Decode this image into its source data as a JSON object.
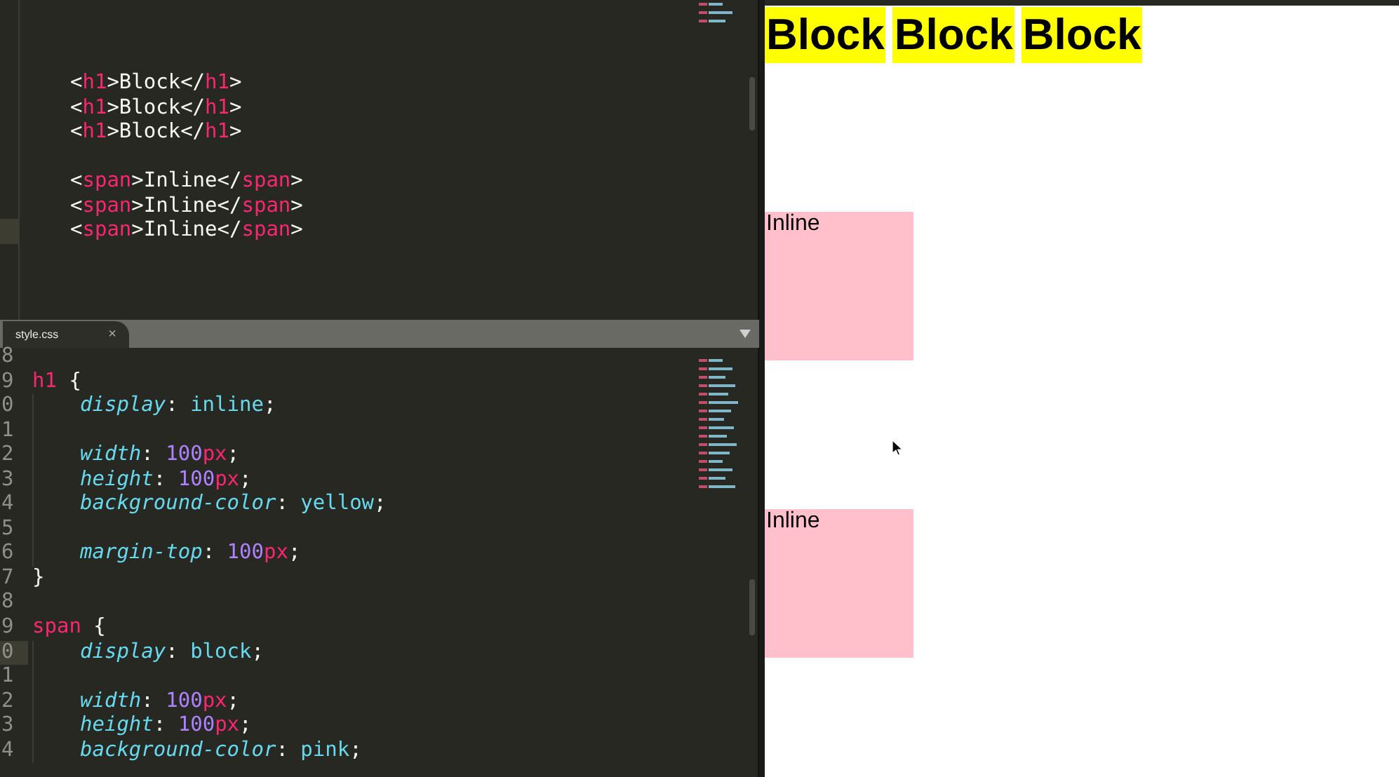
{
  "editor": {
    "html_groups": [
      [
        {
          "current": false,
          "tokens": [
            {
              "kind": "punct",
              "text": "<"
            },
            {
              "kind": "tag",
              "text": "h1"
            },
            {
              "kind": "punct",
              "text": ">Block</"
            },
            {
              "kind": "tag",
              "text": "h1"
            },
            {
              "kind": "punct",
              "text": ">"
            }
          ]
        },
        {
          "current": false,
          "tokens": [
            {
              "kind": "punct",
              "text": "<"
            },
            {
              "kind": "tag",
              "text": "h1"
            },
            {
              "kind": "punct",
              "text": ">Block</"
            },
            {
              "kind": "tag",
              "text": "h1"
            },
            {
              "kind": "punct",
              "text": ">"
            }
          ]
        },
        {
          "current": false,
          "tokens": [
            {
              "kind": "punct",
              "text": "<"
            },
            {
              "kind": "tag",
              "text": "h1"
            },
            {
              "kind": "punct",
              "text": ">Block</"
            },
            {
              "kind": "tag",
              "text": "h1"
            },
            {
              "kind": "punct",
              "text": ">"
            }
          ]
        }
      ],
      [
        {
          "current": false,
          "tokens": [
            {
              "kind": "punct",
              "text": "<"
            },
            {
              "kind": "tag",
              "text": "span"
            },
            {
              "kind": "punct",
              "text": ">Inline</"
            },
            {
              "kind": "tag",
              "text": "span"
            },
            {
              "kind": "punct",
              "text": ">"
            }
          ]
        },
        {
          "current": false,
          "tokens": [
            {
              "kind": "punct",
              "text": "<"
            },
            {
              "kind": "tag",
              "text": "span"
            },
            {
              "kind": "punct",
              "text": ">Inline</"
            },
            {
              "kind": "tag",
              "text": "span"
            },
            {
              "kind": "punct",
              "text": ">"
            }
          ]
        },
        {
          "current": true,
          "tokens": [
            {
              "kind": "punct",
              "text": "<"
            },
            {
              "kind": "tag",
              "text": "span"
            },
            {
              "kind": "punct",
              "text": ">Inline</"
            },
            {
              "kind": "tag",
              "text": "span"
            },
            {
              "kind": "punct",
              "text": ">"
            }
          ]
        }
      ]
    ],
    "tab": {
      "label": "style.css",
      "close": "×"
    },
    "css_lines": [
      {
        "number": "8",
        "current": false,
        "indent": false
      },
      {
        "number": "9",
        "current": false,
        "indent": false,
        "tokens": [
          {
            "kind": "tag",
            "text": "h1"
          },
          {
            "kind": "punct",
            "text": " {"
          }
        ]
      },
      {
        "number": "0",
        "current": false,
        "indent": true,
        "tokens": [
          {
            "kind": "property",
            "text": "display"
          },
          {
            "kind": "punct",
            "text": ": "
          },
          {
            "kind": "value",
            "text": "inline"
          },
          {
            "kind": "punct",
            "text": ";"
          }
        ]
      },
      {
        "number": "1",
        "current": false,
        "indent": true
      },
      {
        "number": "2",
        "current": false,
        "indent": true,
        "tokens": [
          {
            "kind": "property",
            "text": "width"
          },
          {
            "kind": "punct",
            "text": ": "
          },
          {
            "kind": "number",
            "text": "100"
          },
          {
            "kind": "unit",
            "text": "px"
          },
          {
            "kind": "punct",
            "text": ";"
          }
        ]
      },
      {
        "number": "3",
        "current": false,
        "indent": true,
        "tokens": [
          {
            "kind": "property",
            "text": "height"
          },
          {
            "kind": "punct",
            "text": ": "
          },
          {
            "kind": "number",
            "text": "100"
          },
          {
            "kind": "unit",
            "text": "px"
          },
          {
            "kind": "punct",
            "text": ";"
          }
        ]
      },
      {
        "number": "4",
        "current": false,
        "indent": true,
        "tokens": [
          {
            "kind": "property",
            "text": "background-color"
          },
          {
            "kind": "punct",
            "text": ": "
          },
          {
            "kind": "value",
            "text": "yellow"
          },
          {
            "kind": "punct",
            "text": ";"
          }
        ]
      },
      {
        "number": "5",
        "current": false,
        "indent": true
      },
      {
        "number": "6",
        "current": false,
        "indent": true,
        "tokens": [
          {
            "kind": "property",
            "text": "margin-top"
          },
          {
            "kind": "punct",
            "text": ": "
          },
          {
            "kind": "number",
            "text": "100"
          },
          {
            "kind": "unit",
            "text": "px"
          },
          {
            "kind": "punct",
            "text": ";"
          }
        ]
      },
      {
        "number": "7",
        "current": false,
        "indent": false,
        "tokens": [
          {
            "kind": "punct",
            "text": "}"
          }
        ]
      },
      {
        "number": "8",
        "current": false,
        "indent": false
      },
      {
        "number": "9",
        "current": false,
        "indent": false,
        "tokens": [
          {
            "kind": "tag",
            "text": "span"
          },
          {
            "kind": "punct",
            "text": " {"
          }
        ]
      },
      {
        "number": "0",
        "current": true,
        "indent": true,
        "tokens": [
          {
            "kind": "property",
            "text": "display"
          },
          {
            "kind": "punct",
            "text": ": "
          },
          {
            "kind": "value",
            "text": "block"
          },
          {
            "kind": "punct",
            "text": ";"
          }
        ]
      },
      {
        "number": "1",
        "current": false,
        "indent": true
      },
      {
        "number": "2",
        "current": false,
        "indent": true,
        "tokens": [
          {
            "kind": "property",
            "text": "width"
          },
          {
            "kind": "punct",
            "text": ": "
          },
          {
            "kind": "number",
            "text": "100"
          },
          {
            "kind": "unit",
            "text": "px"
          },
          {
            "kind": "punct",
            "text": ";"
          }
        ]
      },
      {
        "number": "3",
        "current": false,
        "indent": true,
        "tokens": [
          {
            "kind": "property",
            "text": "height"
          },
          {
            "kind": "punct",
            "text": ": "
          },
          {
            "kind": "number",
            "text": "100"
          },
          {
            "kind": "unit",
            "text": "px"
          },
          {
            "kind": "punct",
            "text": ";"
          }
        ]
      },
      {
        "number": "4",
        "current": false,
        "indent": true,
        "tokens": [
          {
            "kind": "property",
            "text": "background-color"
          },
          {
            "kind": "punct",
            "text": ": "
          },
          {
            "kind": "value",
            "text": "pink"
          },
          {
            "kind": "punct",
            "text": ";"
          }
        ]
      }
    ]
  },
  "preview": {
    "headings": [
      "Block",
      "Block",
      "Block"
    ],
    "boxes": [
      "Inline",
      "Inline"
    ]
  }
}
